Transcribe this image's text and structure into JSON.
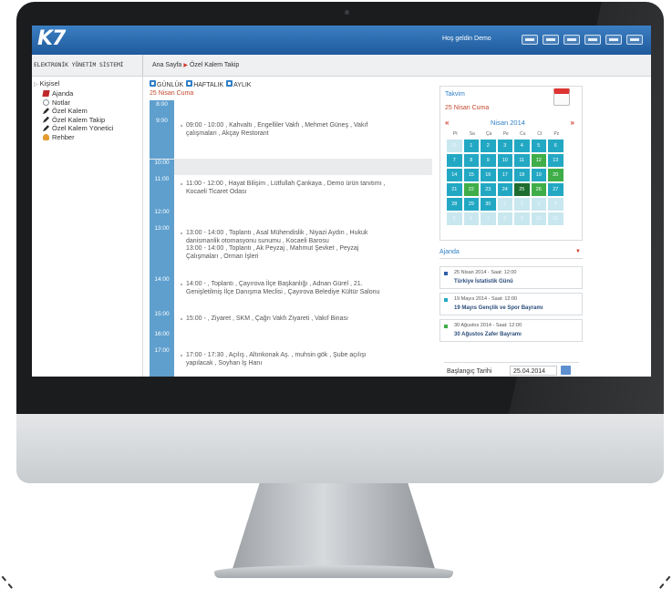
{
  "app": {
    "logo": "K7",
    "welcome": "Hoş geldin Demo",
    "system_title": "ELEKTRONİK YÖNETİM SİSTEMİ"
  },
  "header_icons": [
    "list-icon",
    "grid-icon",
    "table-icon",
    "calendar-icon",
    "users-icon",
    "logout-icon"
  ],
  "breadcrumb": {
    "home": "Ana Sayfa",
    "current": "Özel Kalem Takip"
  },
  "sidebar": {
    "root": "Kişisel",
    "items": [
      {
        "label": "Ajanda",
        "icon": "ajanda-icon"
      },
      {
        "label": "Notlar",
        "icon": "notes-icon"
      },
      {
        "label": "Özel Kalem",
        "icon": "pen-icon"
      },
      {
        "label": "Özel Kalem Takip",
        "icon": "pen-icon"
      },
      {
        "label": "Özel Kalem Yönetici",
        "icon": "pen-icon"
      },
      {
        "label": "Rehber",
        "icon": "contacts-icon"
      }
    ]
  },
  "view_tabs": [
    "GÜNLÜK",
    "HAFTALIK",
    "AYLIK"
  ],
  "date_label": "25 Nisan Cuma",
  "schedule": [
    {
      "time": "8:00",
      "lines": []
    },
    {
      "time": "9:00",
      "lines": [
        "09:00 - 10:00 , Kahvaltı , Engelliler Vakfı , Mehmet Güneş , Vakıf",
        "çalışmaları , Akçay Restorant"
      ]
    },
    {
      "time": "10:00",
      "lines": []
    },
    {
      "time": "11:00",
      "lines": [
        "11:00 - 12:00 , Hayat Bilişim , Lütfullah Çankaya , Demo ürün tanıtımı ,",
        "Kocaeli Ticaret Odası"
      ]
    },
    {
      "time": "12:00",
      "lines": []
    },
    {
      "time": "13:00",
      "lines": [
        "13:00 - 14:00 , Toplantı , Asal Mühendislik , Niyazi Aydın , Hukuk",
        "danismanlik otomasyonu sunumu , Kocaeli Barosu",
        "13:00 - 14:00 , Toplantı , Ak Peyzaj , Mahmut Şevket , Peyzaj",
        "Çalışmaları , Orman İşleri"
      ]
    },
    {
      "time": "14:00",
      "lines": [
        "14:00 - , Toplantı , Çayırova İlçe Başkanlığı , Adnan Gürel , 21.",
        "Genişletilmiş İlçe Danışma Meclisi , Çayırova Belediye Kültür Salonu"
      ]
    },
    {
      "time": "15:00",
      "lines": [
        "15:00 - , Ziyaret , SKM , Çağrı Vakfı Ziyareti , Vakıf Binası"
      ]
    },
    {
      "time": "16:00",
      "lines": []
    },
    {
      "time": "17:00",
      "lines": [
        "17:00 - 17:30 , Açılış , Altınkonak Aş. , muhsin gök , Şube açılışı",
        "yapılacak , Soyhan İş Hanı"
      ]
    }
  ],
  "calendar": {
    "title": "Takvim",
    "date": "25 Nisan Cuma",
    "prev": "«",
    "next": "»",
    "month": "Nisan 2014",
    "dow": [
      "Pt",
      "Sa",
      "Ça",
      "Pe",
      "Cu",
      "Ct",
      "Pz"
    ],
    "days": [
      {
        "n": "31",
        "s": "o"
      },
      {
        "n": "1",
        "s": ""
      },
      {
        "n": "2",
        "s": ""
      },
      {
        "n": "3",
        "s": ""
      },
      {
        "n": "4",
        "s": ""
      },
      {
        "n": "5",
        "s": ""
      },
      {
        "n": "6",
        "s": ""
      },
      {
        "n": "7",
        "s": ""
      },
      {
        "n": "8",
        "s": ""
      },
      {
        "n": "9",
        "s": ""
      },
      {
        "n": "10",
        "s": ""
      },
      {
        "n": "11",
        "s": ""
      },
      {
        "n": "12",
        "s": "g"
      },
      {
        "n": "13",
        "s": ""
      },
      {
        "n": "14",
        "s": ""
      },
      {
        "n": "15",
        "s": ""
      },
      {
        "n": "16",
        "s": ""
      },
      {
        "n": "17",
        "s": ""
      },
      {
        "n": "18",
        "s": ""
      },
      {
        "n": "19",
        "s": ""
      },
      {
        "n": "20",
        "s": "g"
      },
      {
        "n": "21",
        "s": ""
      },
      {
        "n": "22",
        "s": "g"
      },
      {
        "n": "23",
        "s": ""
      },
      {
        "n": "24",
        "s": ""
      },
      {
        "n": "25",
        "s": "t"
      },
      {
        "n": "26",
        "s": "g"
      },
      {
        "n": "27",
        "s": ""
      },
      {
        "n": "28",
        "s": ""
      },
      {
        "n": "29",
        "s": ""
      },
      {
        "n": "30",
        "s": ""
      },
      {
        "n": "1",
        "s": "o"
      },
      {
        "n": "2",
        "s": "o"
      },
      {
        "n": "3",
        "s": "o"
      },
      {
        "n": "4",
        "s": "o"
      },
      {
        "n": "5",
        "s": "o"
      },
      {
        "n": "6",
        "s": "o"
      },
      {
        "n": "7",
        "s": "o"
      },
      {
        "n": "8",
        "s": "o"
      },
      {
        "n": "9",
        "s": "o"
      },
      {
        "n": "10",
        "s": "o"
      },
      {
        "n": "11",
        "s": "o"
      }
    ]
  },
  "agenda": {
    "title": "Ajanda",
    "items": [
      {
        "date": "25 Nisan 2014 - Saat: 12:00",
        "title": "Türkiye İstatistik Günü",
        "color": "#2f5fa8"
      },
      {
        "date": "19 Mayıs 2014 - Saat: 12:00",
        "title": "19 Mayıs Gençlik ve Spor Bayramı",
        "color": "#23a8c4"
      },
      {
        "date": "30 Ağustos 2014 - Saat: 12:00",
        "title": "30 Ağustos Zafer Bayramı",
        "color": "#3fae49"
      }
    ]
  },
  "start_date": {
    "label": "Başlangıç Tarihi",
    "value": "25.04.2014"
  }
}
